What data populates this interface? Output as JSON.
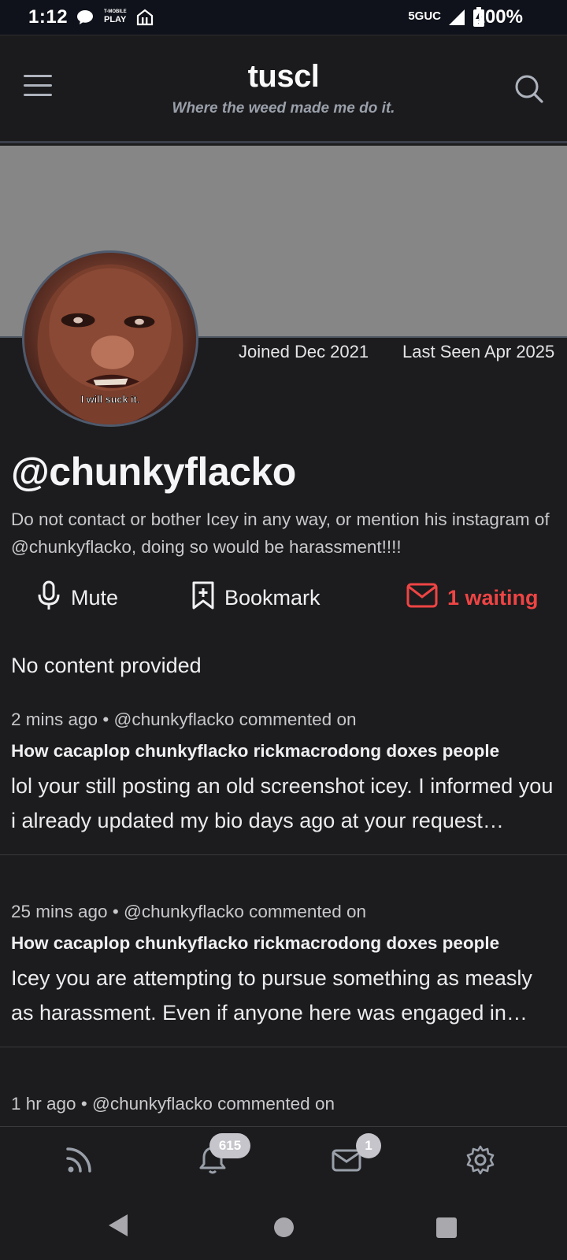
{
  "status_bar": {
    "time": "1:12",
    "network": "5GUC",
    "battery": "100%",
    "notif_icons": [
      "chat-bubble-icon",
      "tmobile-play-icon",
      "tmobile-app-icon"
    ],
    "play_label": "PLAY"
  },
  "header": {
    "title": "tuscl",
    "tagline": "Where the weed made me do it."
  },
  "profile": {
    "joined": "Joined Dec 2021",
    "last_seen": "Last Seen Apr 2025",
    "username": "@chunkyflacko",
    "bio": "Do not contact or bother Icey in any way, or mention his instagram of @chunkyflacko, doing so would be harassment!!!!",
    "avatar_caption": "I will suck it."
  },
  "actions": {
    "mute": "Mute",
    "bookmark": "Bookmark",
    "messages": "1 waiting"
  },
  "no_content": "No content provided",
  "posts": [
    {
      "time": "2 mins ago",
      "sep": "•",
      "author": "@chunkyflacko commented on",
      "title": "How cacaplop chunkyflacko rickmacrodong doxes people",
      "body": "lol your still posting an old screenshot icey. I informed you i already updated my bio days ago at your request…"
    },
    {
      "time": "25 mins ago",
      "sep": "•",
      "author": "@chunkyflacko commented on",
      "title": "How cacaplop chunkyflacko rickmacrodong doxes people",
      "body": "Icey you are attempting to pursue something as measly as harassment. Even if anyone here was engaged in…"
    },
    {
      "time": "1 hr ago",
      "sep": "•",
      "author": "@chunkyflacko commented on",
      "title": "",
      "body": ""
    }
  ],
  "bottom_nav": {
    "notifications_count": "615",
    "messages_count": "1"
  },
  "colors": {
    "accent_red": "#ef4444",
    "background": "#1c1c1e",
    "banner": "#868686"
  }
}
